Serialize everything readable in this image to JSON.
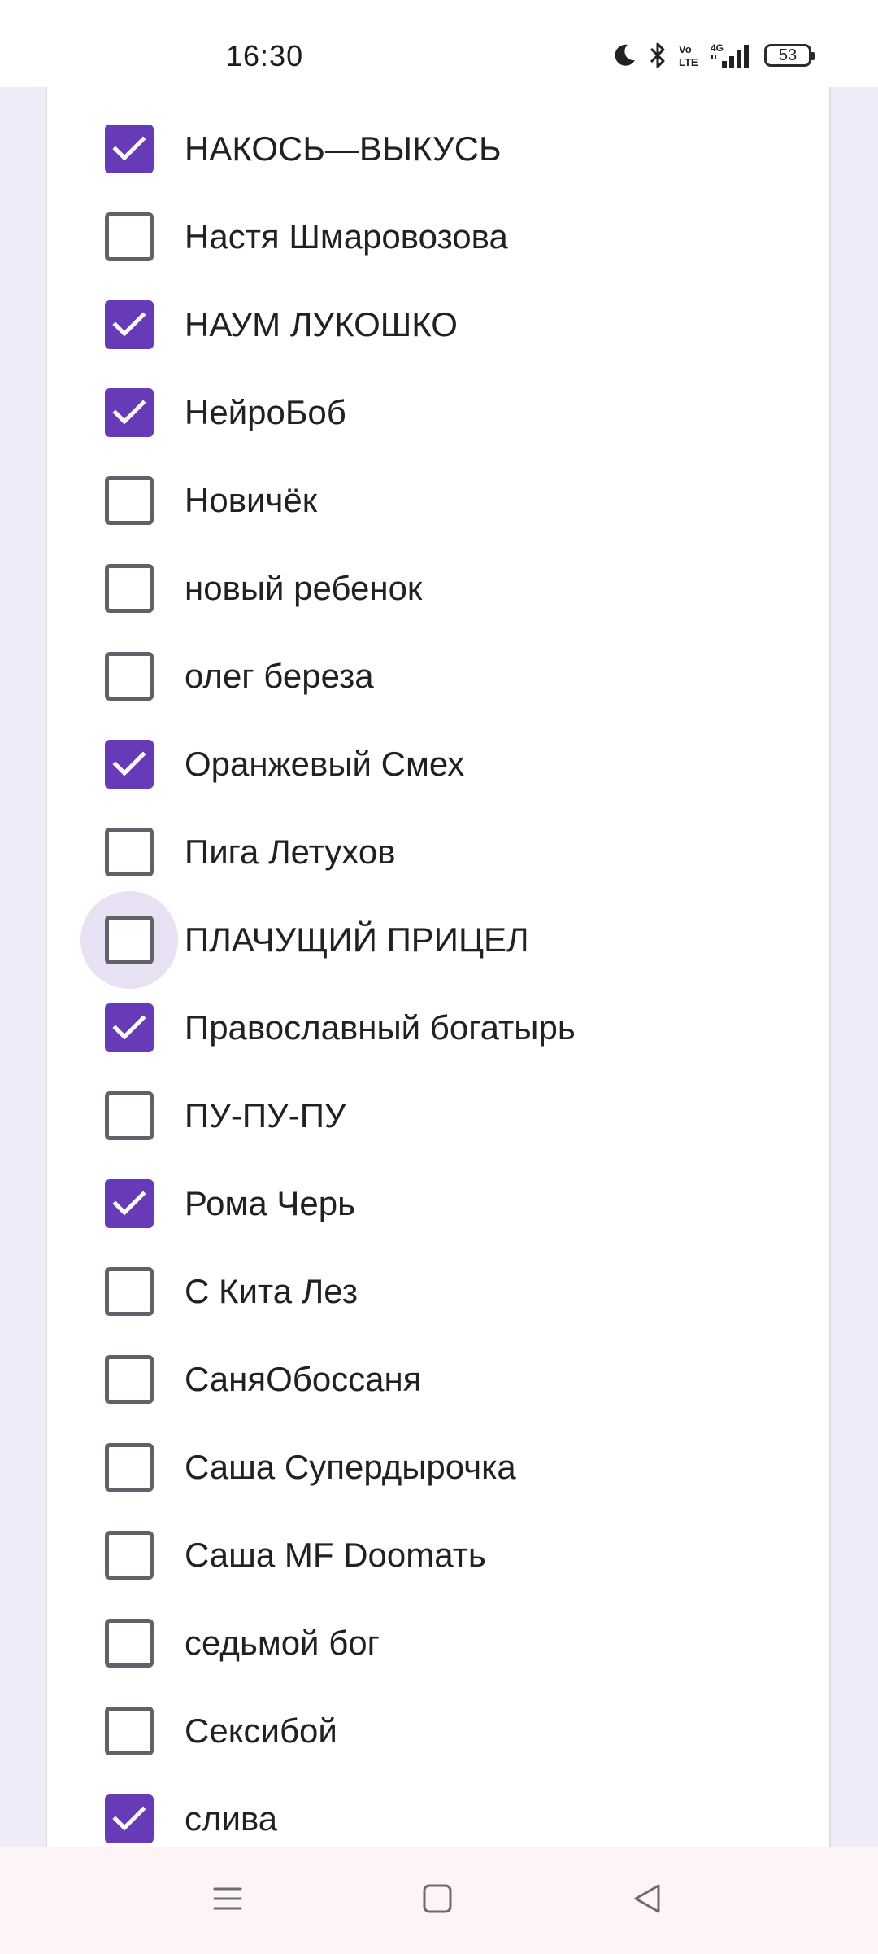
{
  "status_bar": {
    "time": "16:30",
    "battery_level": "53",
    "icons": [
      "moon-icon",
      "bluetooth-icon",
      "volte-icon",
      "4g-signal-icon",
      "battery-icon"
    ]
  },
  "options": [
    {
      "label": "НАКОСЬ—ВЫКУСЬ",
      "checked": true
    },
    {
      "label": "Настя Шмаровозова",
      "checked": false
    },
    {
      "label": "НАУМ ЛУКОШКО",
      "checked": true
    },
    {
      "label": "НейроБоб",
      "checked": true
    },
    {
      "label": "Новичёк",
      "checked": false
    },
    {
      "label": "новый ребенок",
      "checked": false
    },
    {
      "label": "олег береза",
      "checked": false
    },
    {
      "label": "Оранжевый Смех",
      "checked": true
    },
    {
      "label": "Пига Летухов",
      "checked": false
    },
    {
      "label": "ПЛАЧУЩИЙ ПРИЦЕЛ",
      "checked": false,
      "focused": true
    },
    {
      "label": "Православный богатырь",
      "checked": true
    },
    {
      "label": "ПУ-ПУ-ПУ",
      "checked": false
    },
    {
      "label": "Рома Черь",
      "checked": true
    },
    {
      "label": "С Кита Лез",
      "checked": false
    },
    {
      "label": "СаняОбоссаня",
      "checked": false
    },
    {
      "label": "Саша Супердырочка",
      "checked": false
    },
    {
      "label": "Саша MF Doomать",
      "checked": false
    },
    {
      "label": "седьмой бог",
      "checked": false
    },
    {
      "label": "Сексибой",
      "checked": false
    },
    {
      "label": "слива",
      "checked": true
    }
  ],
  "colors": {
    "accent": "#673ab7",
    "unchecked_border": "#5f6368",
    "focus_ring": "#e7e1f3",
    "page_background": "#efebf8"
  },
  "nav_bar": {
    "buttons": [
      "menu-icon",
      "home-square-icon",
      "back-triangle-icon"
    ]
  }
}
